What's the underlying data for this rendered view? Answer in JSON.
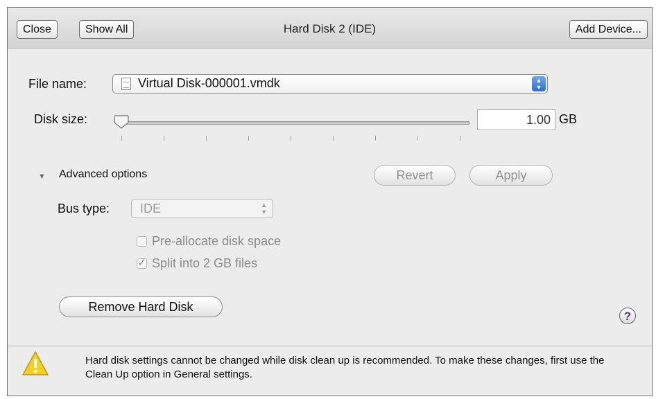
{
  "toolbar": {
    "close_label": "Close",
    "show_all_label": "Show All",
    "title": "Hard Disk 2 (IDE)",
    "add_device_label": "Add Device..."
  },
  "file_name": {
    "label": "File name:",
    "value": "Virtual Disk-000001.vmdk",
    "icon": "document-icon"
  },
  "disk_size": {
    "label": "Disk size:",
    "value": "1.00",
    "unit": "GB",
    "slider_level": 0
  },
  "advanced": {
    "label": "Advanced options",
    "expanded": true,
    "revert_label": "Revert",
    "apply_label": "Apply",
    "bus_type_label": "Bus type:",
    "bus_type_value": "IDE",
    "preallocate_label": "Pre-allocate disk space",
    "preallocate_checked": false,
    "split_label": "Split into 2 GB files",
    "split_checked": true
  },
  "remove_label": "Remove Hard Disk",
  "help_label": "?",
  "footer": {
    "icon": "warning-icon",
    "message": "Hard disk settings cannot be changed while disk clean up is recommended. To make these changes, first use the Clean Up option in General settings."
  },
  "colors": {
    "accent": "#2a6fd8",
    "warning": "#f5d020",
    "help": "#5a2b8a"
  }
}
